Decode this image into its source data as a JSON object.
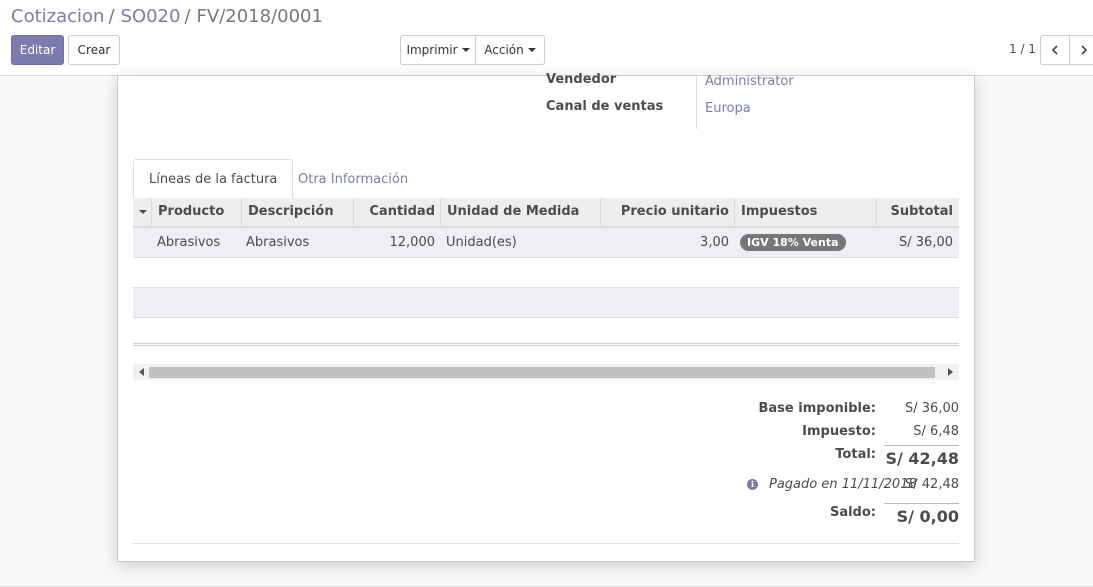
{
  "breadcrumb": {
    "items": [
      "Cotizacion",
      "SO020"
    ],
    "active": "FV/2018/0001",
    "separator": "/"
  },
  "toolbar": {
    "edit_label": "Editar",
    "create_label": "Crear",
    "print_label": "Imprimir",
    "action_label": "Acción"
  },
  "pager": {
    "value": "1 / 1"
  },
  "fields": {
    "salesperson_label": "Vendedor",
    "salesperson_value": "Administrator",
    "channel_label": "Canal de ventas",
    "channel_value": "Europa"
  },
  "tabs": [
    {
      "label": "Líneas de la factura",
      "active": true
    },
    {
      "label": "Otra Información",
      "active": false
    }
  ],
  "table": {
    "columns": [
      "Producto",
      "Descripción",
      "Cantidad",
      "Unidad de Medida",
      "Precio unitario",
      "Impuestos",
      "Subtotal"
    ],
    "rows": [
      {
        "producto": "Abrasivos",
        "descripcion": "Abrasivos",
        "cantidad": "12,000",
        "unidad": "Unidad(es)",
        "precio": "3,00",
        "impuesto": "IGV 18% Venta",
        "subtotal": "S/ 36,00"
      }
    ]
  },
  "totals": {
    "base_label": "Base imponible:",
    "base_value": "S/ 36,00",
    "tax_label": "Impuesto:",
    "tax_value": "S/ 6,48",
    "total_label": "Total:",
    "total_value": "S/ 42,48",
    "payment_text": "Pagado en 11/11/2018",
    "payment_value": "S/ 42,48",
    "balance_label": "Saldo:",
    "balance_value": "S/ 0,00"
  },
  "icons": {
    "sort": "caret-down-icon",
    "info": "info-circle-icon",
    "prev": "chevron-left-icon",
    "next": "chevron-right-icon"
  },
  "colors": {
    "accent": "#7c7bad",
    "badge": "#777777"
  }
}
